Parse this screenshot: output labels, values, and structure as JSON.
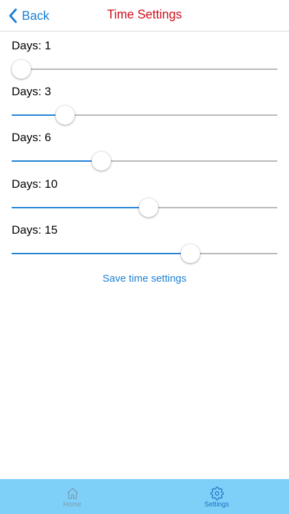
{
  "nav": {
    "back_label": "Back",
    "title": "Time Settings",
    "title_color": "#d0101b",
    "accent_color": "#1a7fd4"
  },
  "sliders": [
    {
      "label": "Days: 1",
      "fraction": 0.035
    },
    {
      "label": "Days: 3",
      "fraction": 0.2
    },
    {
      "label": "Days: 6",
      "fraction": 0.338
    },
    {
      "label": "Days: 10",
      "fraction": 0.515
    },
    {
      "label": "Days: 15",
      "fraction": 0.672
    }
  ],
  "save_label": "Save time settings",
  "tabbar": {
    "background": "#7fd0f9",
    "tabs": [
      {
        "label": "Home",
        "icon": "home-icon",
        "selected": false
      },
      {
        "label": "Settings",
        "icon": "gear-icon",
        "selected": true
      }
    ]
  }
}
